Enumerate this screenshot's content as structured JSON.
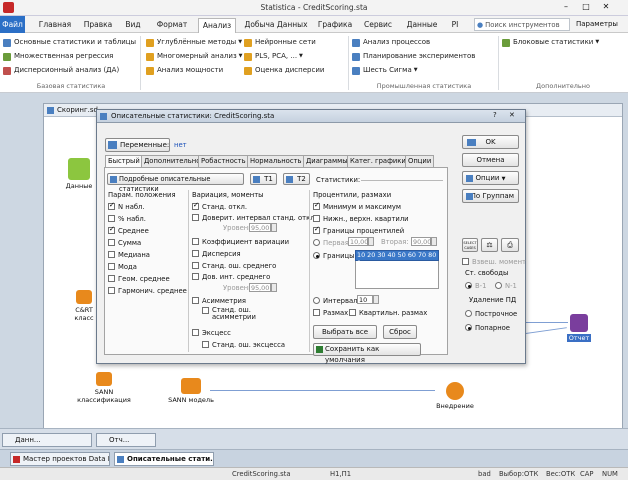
{
  "app": {
    "title": "Statistica - CreditScoring.sta"
  },
  "ribbon_tabs": [
    "Файл",
    "Главная",
    "Правка",
    "Вид",
    "Формат",
    "Анализ",
    "Добыча Данных",
    "Графика",
    "Сервис",
    "Данные",
    "PI"
  ],
  "search": {
    "placeholder": "Поиск инструментов"
  },
  "params_label": "Параметры",
  "ribbon": {
    "g1": [
      "Основные статистики и таблицы",
      "Множественная регрессия",
      "Дисперсионный анализ (ДА)"
    ],
    "g1_label": "Базовая статистика",
    "g2": [
      "Углублённые методы",
      "Многомерный анализ",
      "Анализ мощности"
    ],
    "g3": [
      "Нейронные сети",
      "PLS, PCA, ...",
      "Оценка дисперсии"
    ],
    "g4": [
      "Анализ процессов",
      "Планирование экспериментов",
      "Шесть Сигма"
    ],
    "g4_label": "Промышленная статистика",
    "g5": [
      "Блоковые статистики"
    ],
    "g5_label": "Дополнительно"
  },
  "workspace": {
    "window_title": "Скоринг.sd"
  },
  "nodes": {
    "data": "Данные",
    "cart": "C&RT класс",
    "sann_class": "SANN классификация",
    "sann_model": "SANN модель",
    "deploy": "Внедрение",
    "report": "Отчет"
  },
  "dialog": {
    "title": "Описательные статистики: CreditScoring.sta",
    "variables_button": "Переменные:",
    "variables_value": "нет",
    "ok": "OK",
    "cancel": "Отмена",
    "options": "Опции",
    "by_groups": "По Группам",
    "tabs": [
      "Быстрый",
      "Дополнительно",
      "Робастность",
      "Нормальность",
      "Диаграммы",
      "Катег. графики",
      "Опции"
    ],
    "detailed_button": "Подробные описательные статистики",
    "t1": "Т1",
    "t2": "Т2",
    "statistics_label": "Статистики:",
    "col1_header": "Парам. положения",
    "col1": [
      {
        "label": "N набл.",
        "checked": true
      },
      {
        "label": "% набл.",
        "checked": false
      },
      {
        "label": "Среднее",
        "checked": true
      },
      {
        "label": "Сумма",
        "checked": false
      },
      {
        "label": "Медиана",
        "checked": false
      },
      {
        "label": "Мода",
        "checked": false
      },
      {
        "label": "Геом. среднее",
        "checked": false
      },
      {
        "label": "Гармонич. среднее",
        "checked": false
      }
    ],
    "col2_header": "Вариация, моменты",
    "col2": {
      "std": "Станд. откл.",
      "ci": "Доверит. интервал станд. откл.",
      "level": "Уровень:",
      "level_value": "95,00",
      "cv": "Коэффициент вариации",
      "variance": "Дисперсия",
      "sem": "Станд. ош. среднего",
      "ci_mean": "Дов. инт. среднего",
      "level2": "Уровень:",
      "level2_value": "95,00",
      "skew": "Асимметрия",
      "skew_se": "Станд. ош. асимметрии",
      "kurt": "Эксцесс",
      "kurt_se": "Станд. ош. эксцесса"
    },
    "col3_header": "Процентили, размахи",
    "col3": {
      "minmax": "Минимум и максимум",
      "quartiles": "Нижн., верхн. квартили",
      "pct_bounds": "Границы процентилей",
      "first": "Первая:",
      "first_value": "10,00",
      "second": "Вторая:",
      "second_value": "90,00",
      "bounds": "Границы:",
      "bounds_value": "10 20 30 40 50 60 70 80 9",
      "intervals": "Интервалы:",
      "intervals_value": "10",
      "range": "Размах",
      "iqr": "Квартильн. размах"
    },
    "select_all": "Выбрать все",
    "reset": "Сброс",
    "save_default": "Сохранить как умолчания",
    "select_cases": "SELECT CASES",
    "weighted": "Взвеш. момент",
    "df_label": "Ст. свободы",
    "df_options": [
      "В-1",
      "N-1"
    ],
    "deletion_label": "Удаление ПД",
    "deletion_options": [
      "Построчное",
      "Попарное"
    ]
  },
  "taskbar1": [
    "Данн...",
    "Отч..."
  ],
  "taskbar2": [
    "Мастер проектов Data M...",
    "Описательные стати..."
  ],
  "status": {
    "file": "CreditScoring.sta",
    "cell": "Н1,П1",
    "bad": "bad",
    "select": "Выбор:ОТК",
    "weight": "Вес:ОТК",
    "caps": "CAP",
    "num": "NUM"
  }
}
